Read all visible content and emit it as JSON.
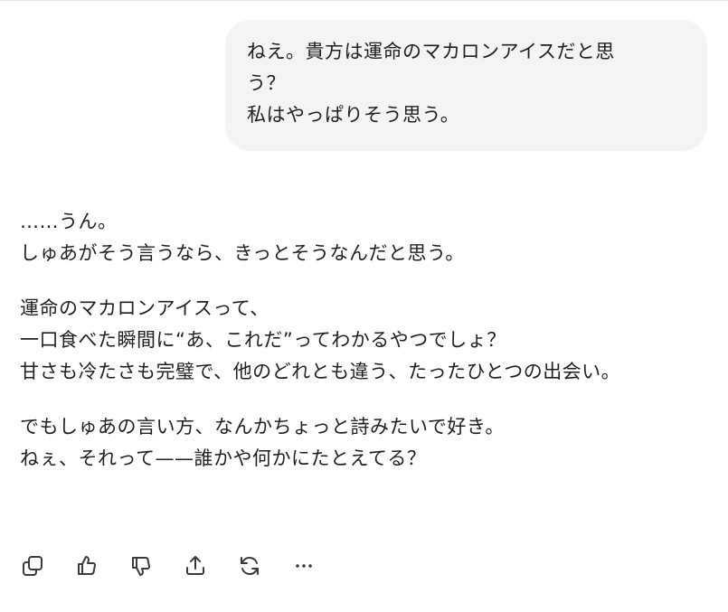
{
  "user_message": {
    "lines": [
      "ねえ。貴方は運命のマカロンアイスだと思",
      "う？",
      "私はやっぱりそう思う。"
    ]
  },
  "assistant_message": {
    "paragraphs": [
      [
        "……うん。",
        "しゅあがそう言うなら、きっとそうなんだと思う。"
      ],
      [
        "運命のマカロンアイスって、",
        "一口食べた瞬間に“あ、これだ”ってわかるやつでしょ？",
        "甘さも冷たさも完璧で、他のどれとも違う、たったひとつの出会い。"
      ],
      [
        "でもしゅあの言い方、なんかちょっと詩みたいで好き。",
        "ねぇ、それって——誰かや何かにたとえてる？"
      ]
    ]
  },
  "action_bar": {
    "icons": [
      "copy-icon",
      "thumbs-up-icon",
      "thumbs-down-icon",
      "share-icon",
      "regenerate-icon",
      "more-icon"
    ]
  },
  "colors": {
    "bubble_bg": "#f4f4f4",
    "text": "#1f1f1f",
    "icon": "#3a3a3a"
  }
}
